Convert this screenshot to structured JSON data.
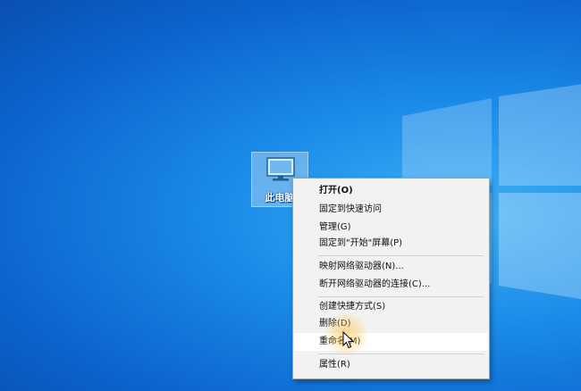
{
  "desktop": {
    "icon": {
      "label": "此电脑",
      "icon_name": "computer-icon"
    },
    "wallpaper": {
      "logo": "windows-logo",
      "colors": [
        "#0a4fb0",
        "#1a8ae8",
        "#3fb0f5"
      ]
    }
  },
  "context_menu": {
    "items": [
      {
        "label": "打开(O)"
      },
      {
        "label": "固定到快速访问"
      },
      {
        "label": "管理(G)"
      },
      {
        "label": "固定到\"开始\"屏幕(P)"
      },
      {
        "label": "映射网络驱动器(N)..."
      },
      {
        "label": "断开网络驱动器的连接(C)..."
      },
      {
        "label": "创建快捷方式(S)"
      },
      {
        "label": "删除(D)"
      },
      {
        "label": "重命名(M)"
      },
      {
        "label": "属性(R)"
      }
    ],
    "hovered_item": "重命名(M)"
  },
  "cursor": {
    "icon_name": "arrow-cursor",
    "highlight_color": "#ffbe3c"
  }
}
